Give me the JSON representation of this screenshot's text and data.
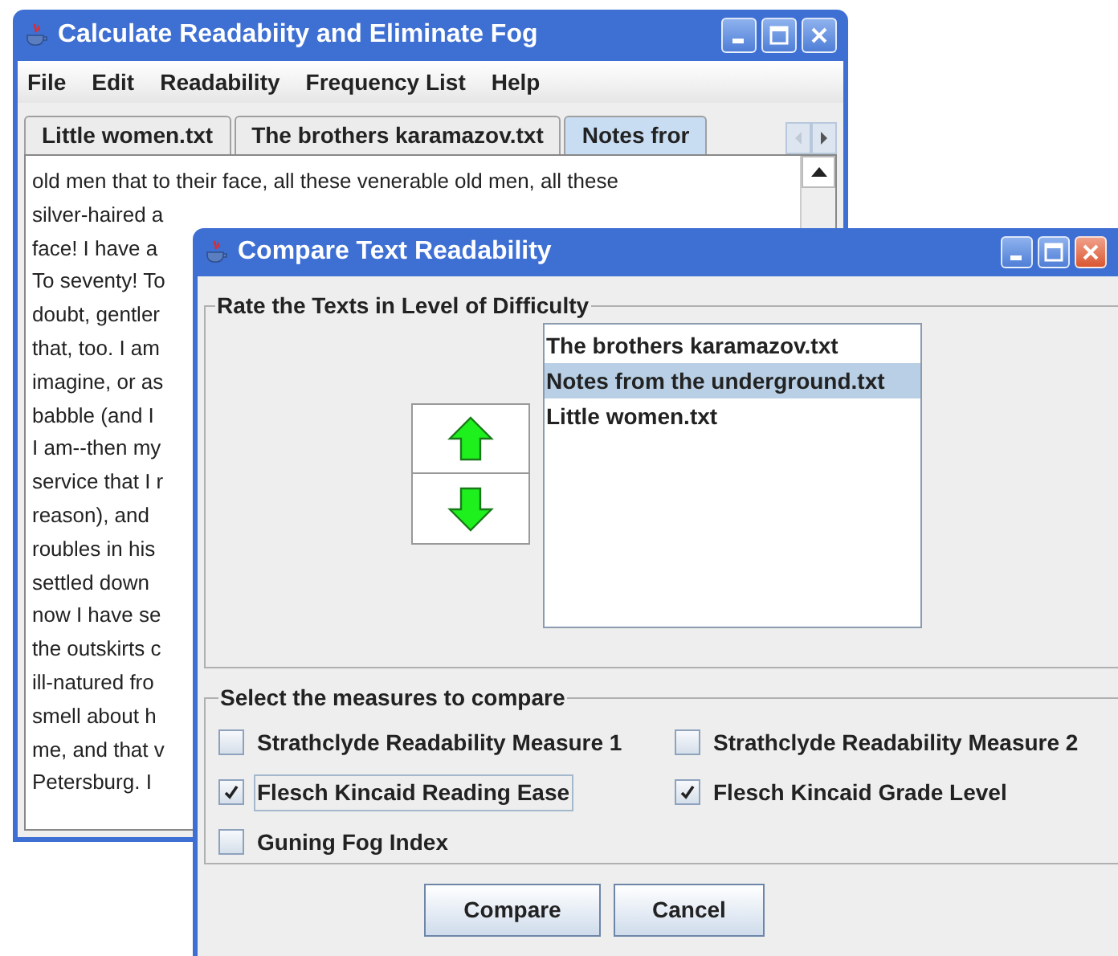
{
  "main_window": {
    "title": "Calculate Readabiity and Eliminate Fog",
    "menu": [
      "File",
      "Edit",
      "Readability",
      "Frequency List",
      "Help"
    ],
    "tabs": [
      {
        "label": "Little women.txt",
        "selected": false
      },
      {
        "label": "The brothers karamazov.txt",
        "selected": false
      },
      {
        "label": "Notes fror",
        "selected": true
      }
    ],
    "text_lines": [
      "old men that to their face, all these venerable old men, all these",
      "silver-haired a",
      "face! I have a",
      "To seventy! To",
      "doubt, gentler",
      "that, too. I am",
      "imagine, or as",
      "babble (and I",
      "I am--then my",
      "service that I r",
      "reason), and",
      "roubles in his",
      "settled down",
      "now I have se",
      "the outskirts c",
      "ill-natured fro",
      "smell about h",
      "me, and that v",
      "Petersburg. I"
    ]
  },
  "dialog": {
    "title": "Compare Text Readability",
    "rank_group": {
      "title": "Rate the Texts in Level of Difficulty",
      "items": [
        {
          "label": "The brothers karamazov.txt",
          "selected": false
        },
        {
          "label": "Notes from the underground.txt",
          "selected": true
        },
        {
          "label": "Little women.txt",
          "selected": false
        }
      ]
    },
    "measures_group": {
      "title": "Select the measures to compare",
      "measures": [
        {
          "label": "Strathclyde Readability Measure 1",
          "checked": false,
          "focused": false
        },
        {
          "label": "Strathclyde Readability Measure 2",
          "checked": false,
          "focused": false
        },
        {
          "label": "Flesch Kincaid Reading Ease",
          "checked": true,
          "focused": true
        },
        {
          "label": "Flesch Kincaid Grade Level",
          "checked": true,
          "focused": false
        },
        {
          "label": "Guning Fog Index",
          "checked": false,
          "focused": false
        }
      ]
    },
    "buttons": [
      "Compare",
      "Cancel"
    ]
  }
}
